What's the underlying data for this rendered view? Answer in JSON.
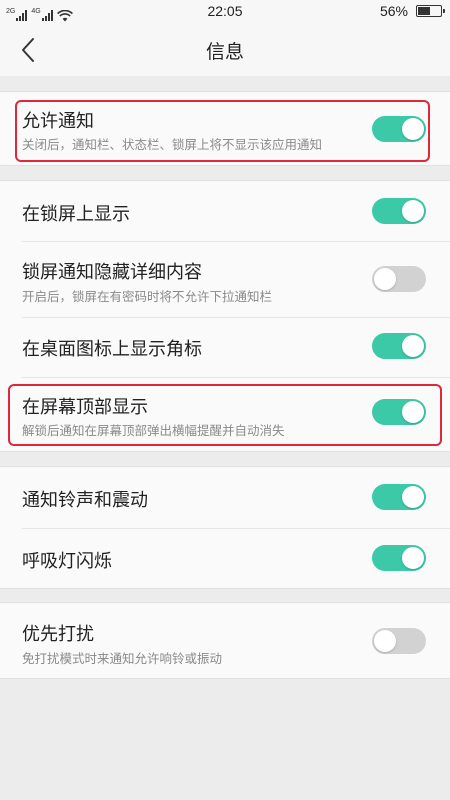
{
  "status_bar": {
    "net_left": "2G",
    "net_right": "4G",
    "time": "22:05",
    "battery_percent": "56%",
    "battery_level": 0.56
  },
  "header": {
    "title": "信息"
  },
  "settings": {
    "allow_notifications": {
      "title": "允许通知",
      "subtitle": "关闭后，通知栏、状态栏、锁屏上将不显示该应用通知",
      "enabled": true
    },
    "show_on_lock_screen": {
      "title": "在锁屏上显示",
      "enabled": true
    },
    "hide_lock_details": {
      "title": "锁屏通知隐藏详细内容",
      "subtitle": "开启后，锁屏在有密码时将不允许下拉通知栏",
      "enabled": false
    },
    "app_badge": {
      "title": "在桌面图标上显示角标",
      "enabled": true
    },
    "show_at_top": {
      "title": "在屏幕顶部显示",
      "subtitle": "解锁后通知在屏幕顶部弹出横幅提醒并自动消失",
      "enabled": true
    },
    "sound_vibration": {
      "title": "通知铃声和震动",
      "enabled": true
    },
    "breathing_light": {
      "title": "呼吸灯闪烁",
      "enabled": true
    },
    "do_not_disturb_priority": {
      "title": "优先打扰",
      "subtitle": "免打扰模式时来通知允许响铃或振动",
      "enabled": false
    }
  },
  "colors": {
    "toggle_on": "#3cc9a8",
    "toggle_off": "#d2d2d2",
    "highlight": "#e0283a"
  }
}
